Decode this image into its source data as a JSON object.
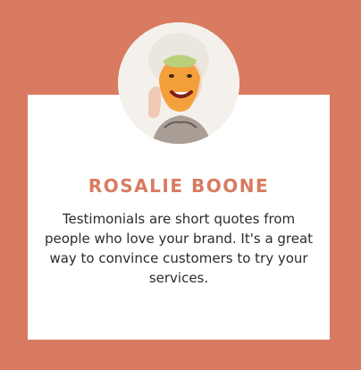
{
  "testimonial": {
    "name": "ROSALIE BOONE",
    "quote": "Testimonials are short quotes from people who love your brand. It's a great way to convince customers to try your services."
  },
  "colors": {
    "background": "#d97b60",
    "card": "#ffffff",
    "accent": "#d97b60",
    "text": "#2b2b2b"
  },
  "icons": {
    "avatar": "portrait-photo"
  }
}
